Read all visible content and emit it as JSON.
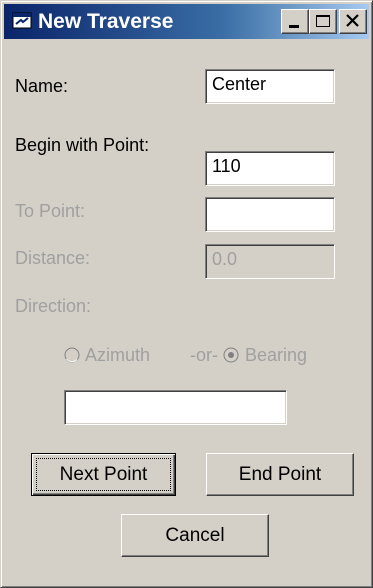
{
  "window": {
    "title": "New Traverse",
    "buttons": {
      "minimize": "minimize-icon",
      "maximize": "maximize-icon",
      "close": "close-icon"
    }
  },
  "form": {
    "name_label": "Name:",
    "name_value": "Center",
    "begin_label": "Begin with Point:",
    "begin_value": "110",
    "to_label": "To Point:",
    "to_value": "",
    "distance_label": "Distance:",
    "distance_value": "0.0",
    "direction_label": "Direction:",
    "azimuth_label": "Azimuth",
    "or_label": "-or-",
    "bearing_label": "Bearing",
    "direction_value": "",
    "selected_direction": "Bearing"
  },
  "actions": {
    "next_point": "Next Point",
    "end_point": "End Point",
    "cancel": "Cancel"
  },
  "colors": {
    "title_gradient_start": "#0a246a",
    "title_gradient_end": "#a6caf0",
    "face": "#d4d0c8",
    "disabled_text": "#a0a0a0"
  }
}
